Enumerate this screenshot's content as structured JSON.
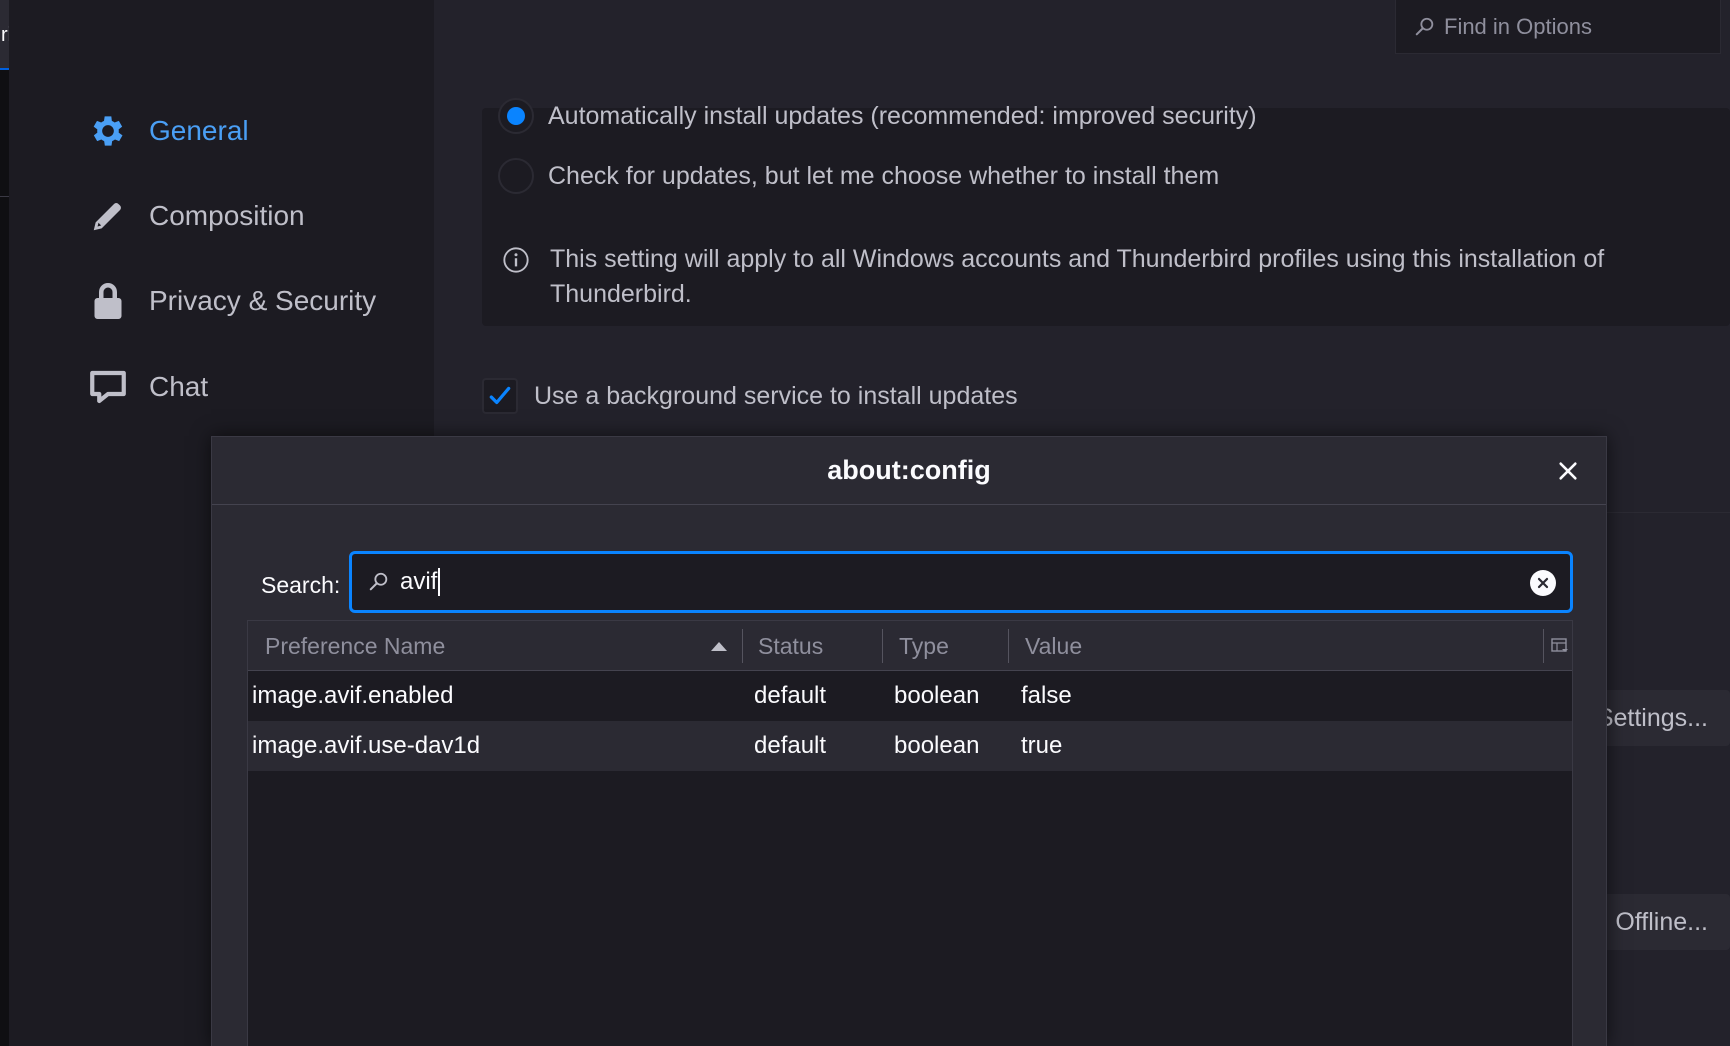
{
  "left_edge": {
    "glyph": "ri"
  },
  "find": {
    "placeholder": "Find in Options"
  },
  "sidebar": {
    "items": [
      {
        "label": "General",
        "icon": "gear-icon",
        "active": true
      },
      {
        "label": "Composition",
        "icon": "pencil-icon",
        "active": false
      },
      {
        "label": "Privacy & Security",
        "icon": "lock-icon",
        "active": false
      },
      {
        "label": "Chat",
        "icon": "chat-icon",
        "active": false
      }
    ]
  },
  "updates": {
    "auto_install": "Automatically install updates (recommended: improved security)",
    "check_only": "Check for updates, but let me choose whether to install them",
    "info": "This setting will apply to all Windows accounts and Thunderbird profiles using this installation of Thunderbird.",
    "background_service": "Use a background service to install updates"
  },
  "side_buttons": {
    "settings": "Settings...",
    "offline": "Offline..."
  },
  "dialog": {
    "title": "about:config",
    "search_label": "Search:",
    "search_value": "avif",
    "columns": {
      "name": "Preference Name",
      "status": "Status",
      "type": "Type",
      "value": "Value"
    },
    "rows": [
      {
        "name": "image.avif.enabled",
        "status": "default",
        "type": "boolean",
        "value": "false"
      },
      {
        "name": "image.avif.use-dav1d",
        "status": "default",
        "type": "boolean",
        "value": "true"
      }
    ]
  },
  "colors": {
    "accent": "#0a84ff",
    "active_nav": "#4a9ff5",
    "background": "#1c1b22",
    "panel": "#2b2a33"
  }
}
